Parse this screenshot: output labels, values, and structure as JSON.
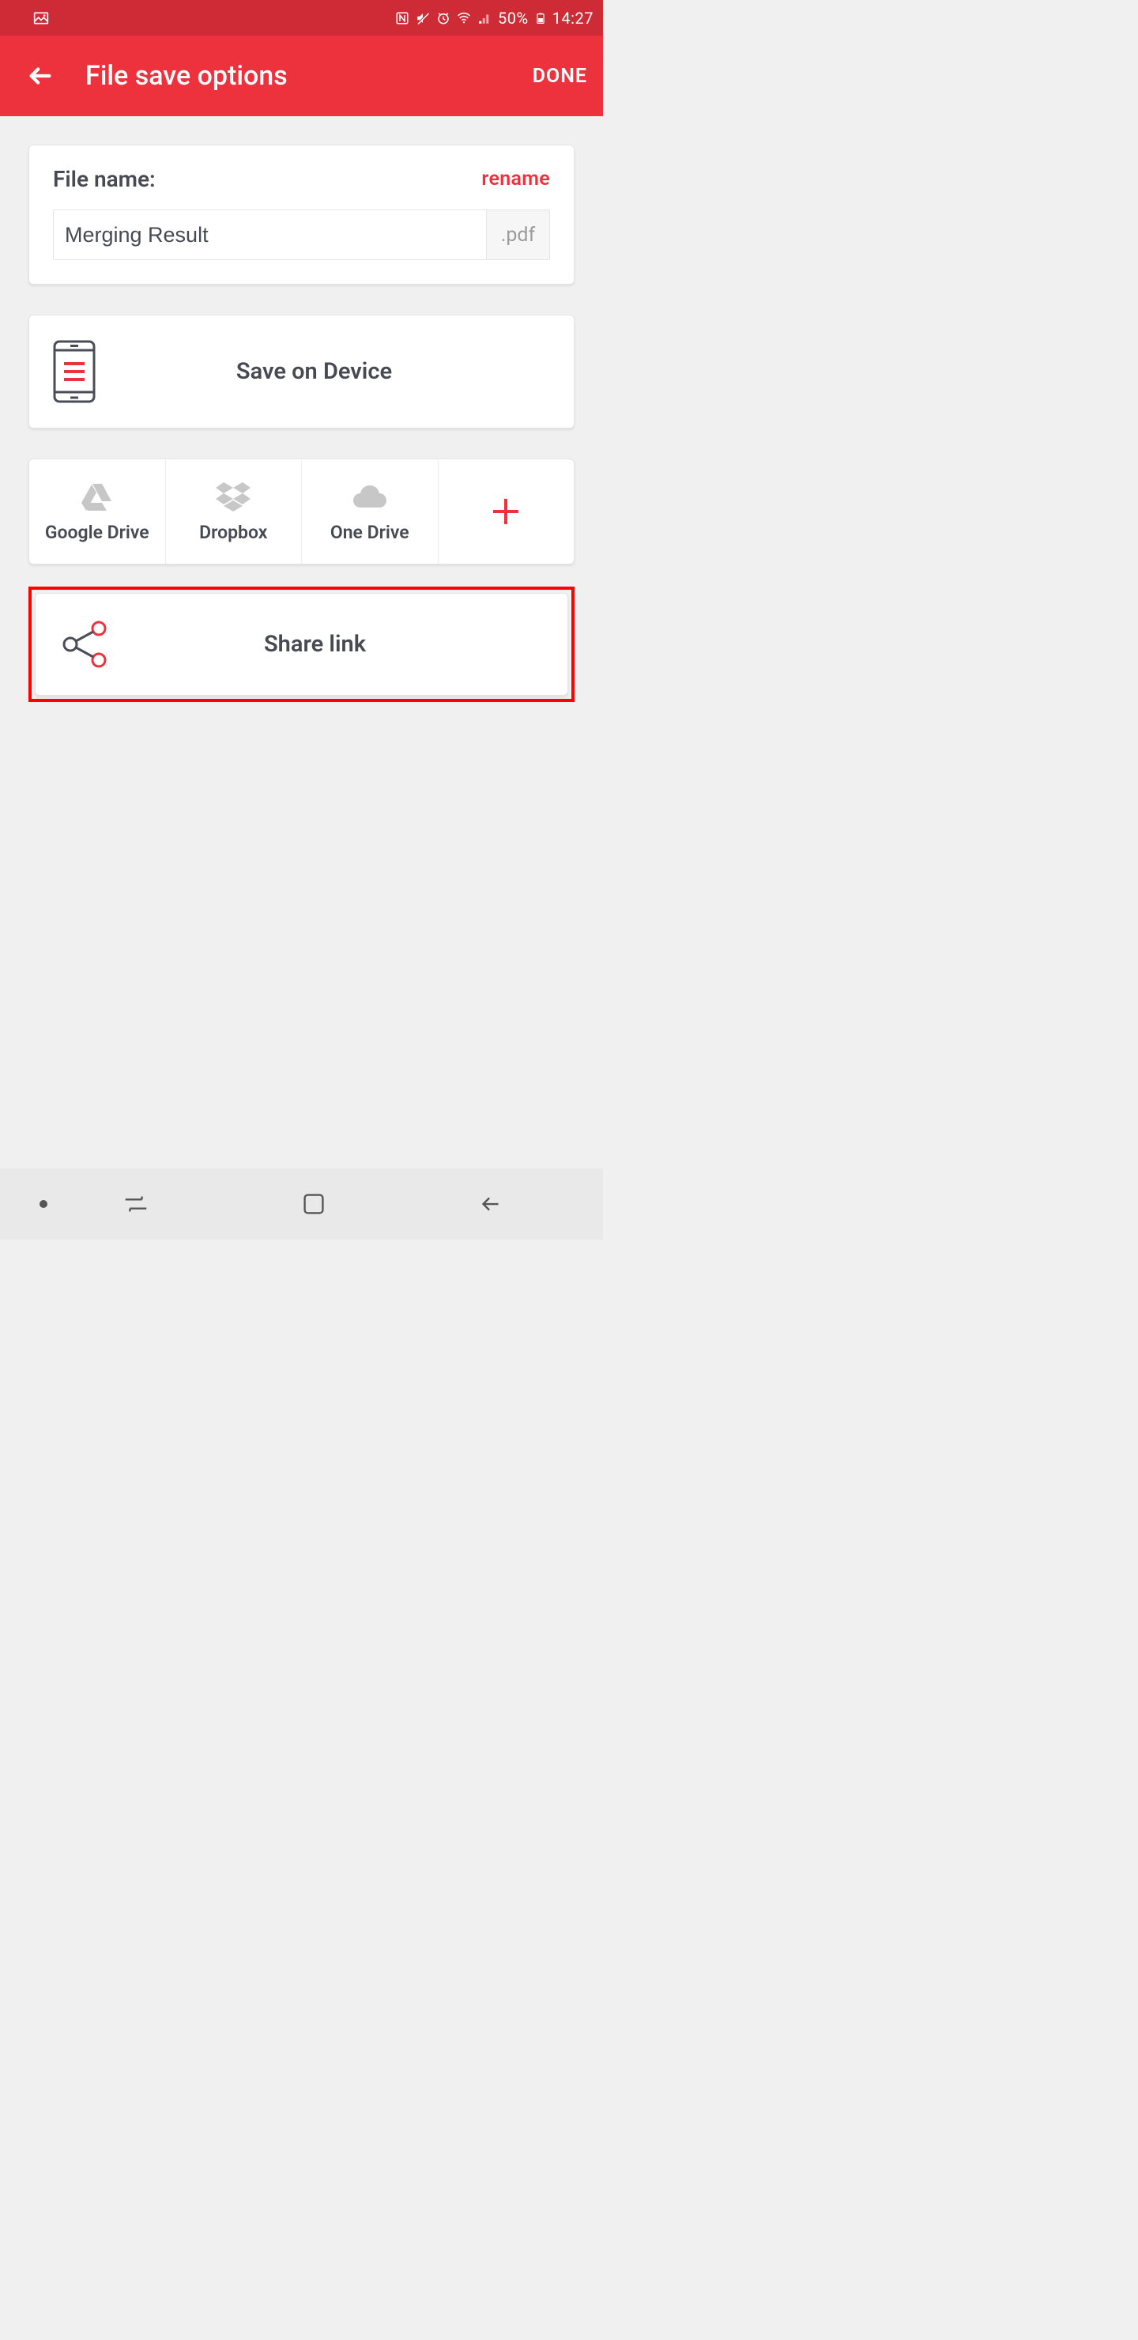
{
  "status": {
    "battery_pct": "50%",
    "time": "14:27"
  },
  "appbar": {
    "title": "File save options",
    "done": "DONE"
  },
  "file": {
    "label": "File name:",
    "rename": "rename",
    "value": "Merging Result",
    "ext": ".pdf"
  },
  "actions": {
    "save_device": "Save on Device",
    "share_link": "Share link"
  },
  "cloud": {
    "gdrive": "Google Drive",
    "dropbox": "Dropbox",
    "onedrive": "One Drive"
  }
}
